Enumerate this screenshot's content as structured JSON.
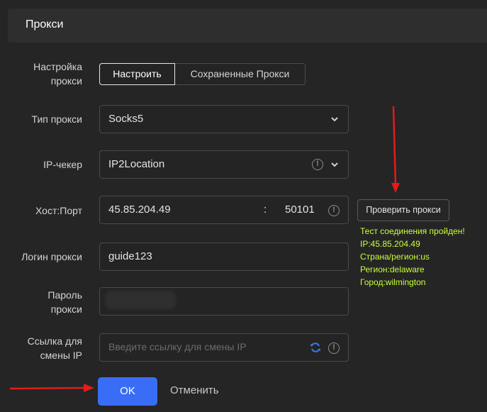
{
  "header": {
    "title": "Прокси"
  },
  "rows": {
    "setup": {
      "label_line1": "Настройка",
      "label_line2": "прокси"
    },
    "type": {
      "label": "Тип прокси",
      "value": "Socks5"
    },
    "checker": {
      "label": "IP-чекер",
      "value": "IP2Location"
    },
    "hostport": {
      "label": "Хост:Порт",
      "host": "45.85.204.49",
      "sep": ":",
      "port": "50101"
    },
    "login": {
      "label": "Логин прокси",
      "value": "guide123"
    },
    "password": {
      "label_line1": "Пароль",
      "label_line2": "прокси"
    },
    "changeip": {
      "label_line1": "Ссылка для",
      "label_line2": "смены IP",
      "placeholder": "Введите ссылку для смены IP"
    }
  },
  "tabs": {
    "configure": "Настроить",
    "saved": "Сохраненные Прокси"
  },
  "check_button": "Проверить прокси",
  "result": {
    "line1": "Тест соединения пройден!",
    "line2": "IP:45.85.204.49",
    "line3": "Страна/регион:us",
    "line4": "Регион:delaware",
    "line5": "Город:wilmington"
  },
  "footer": {
    "ok": "OK",
    "cancel": "Отменить"
  },
  "colors": {
    "accent": "#3a6df5",
    "success": "#c8ff3a",
    "arrow": "#e31b1b"
  },
  "icons": [
    "chevron-down-icon",
    "info-icon",
    "refresh-icon",
    "arrow-icon"
  ]
}
